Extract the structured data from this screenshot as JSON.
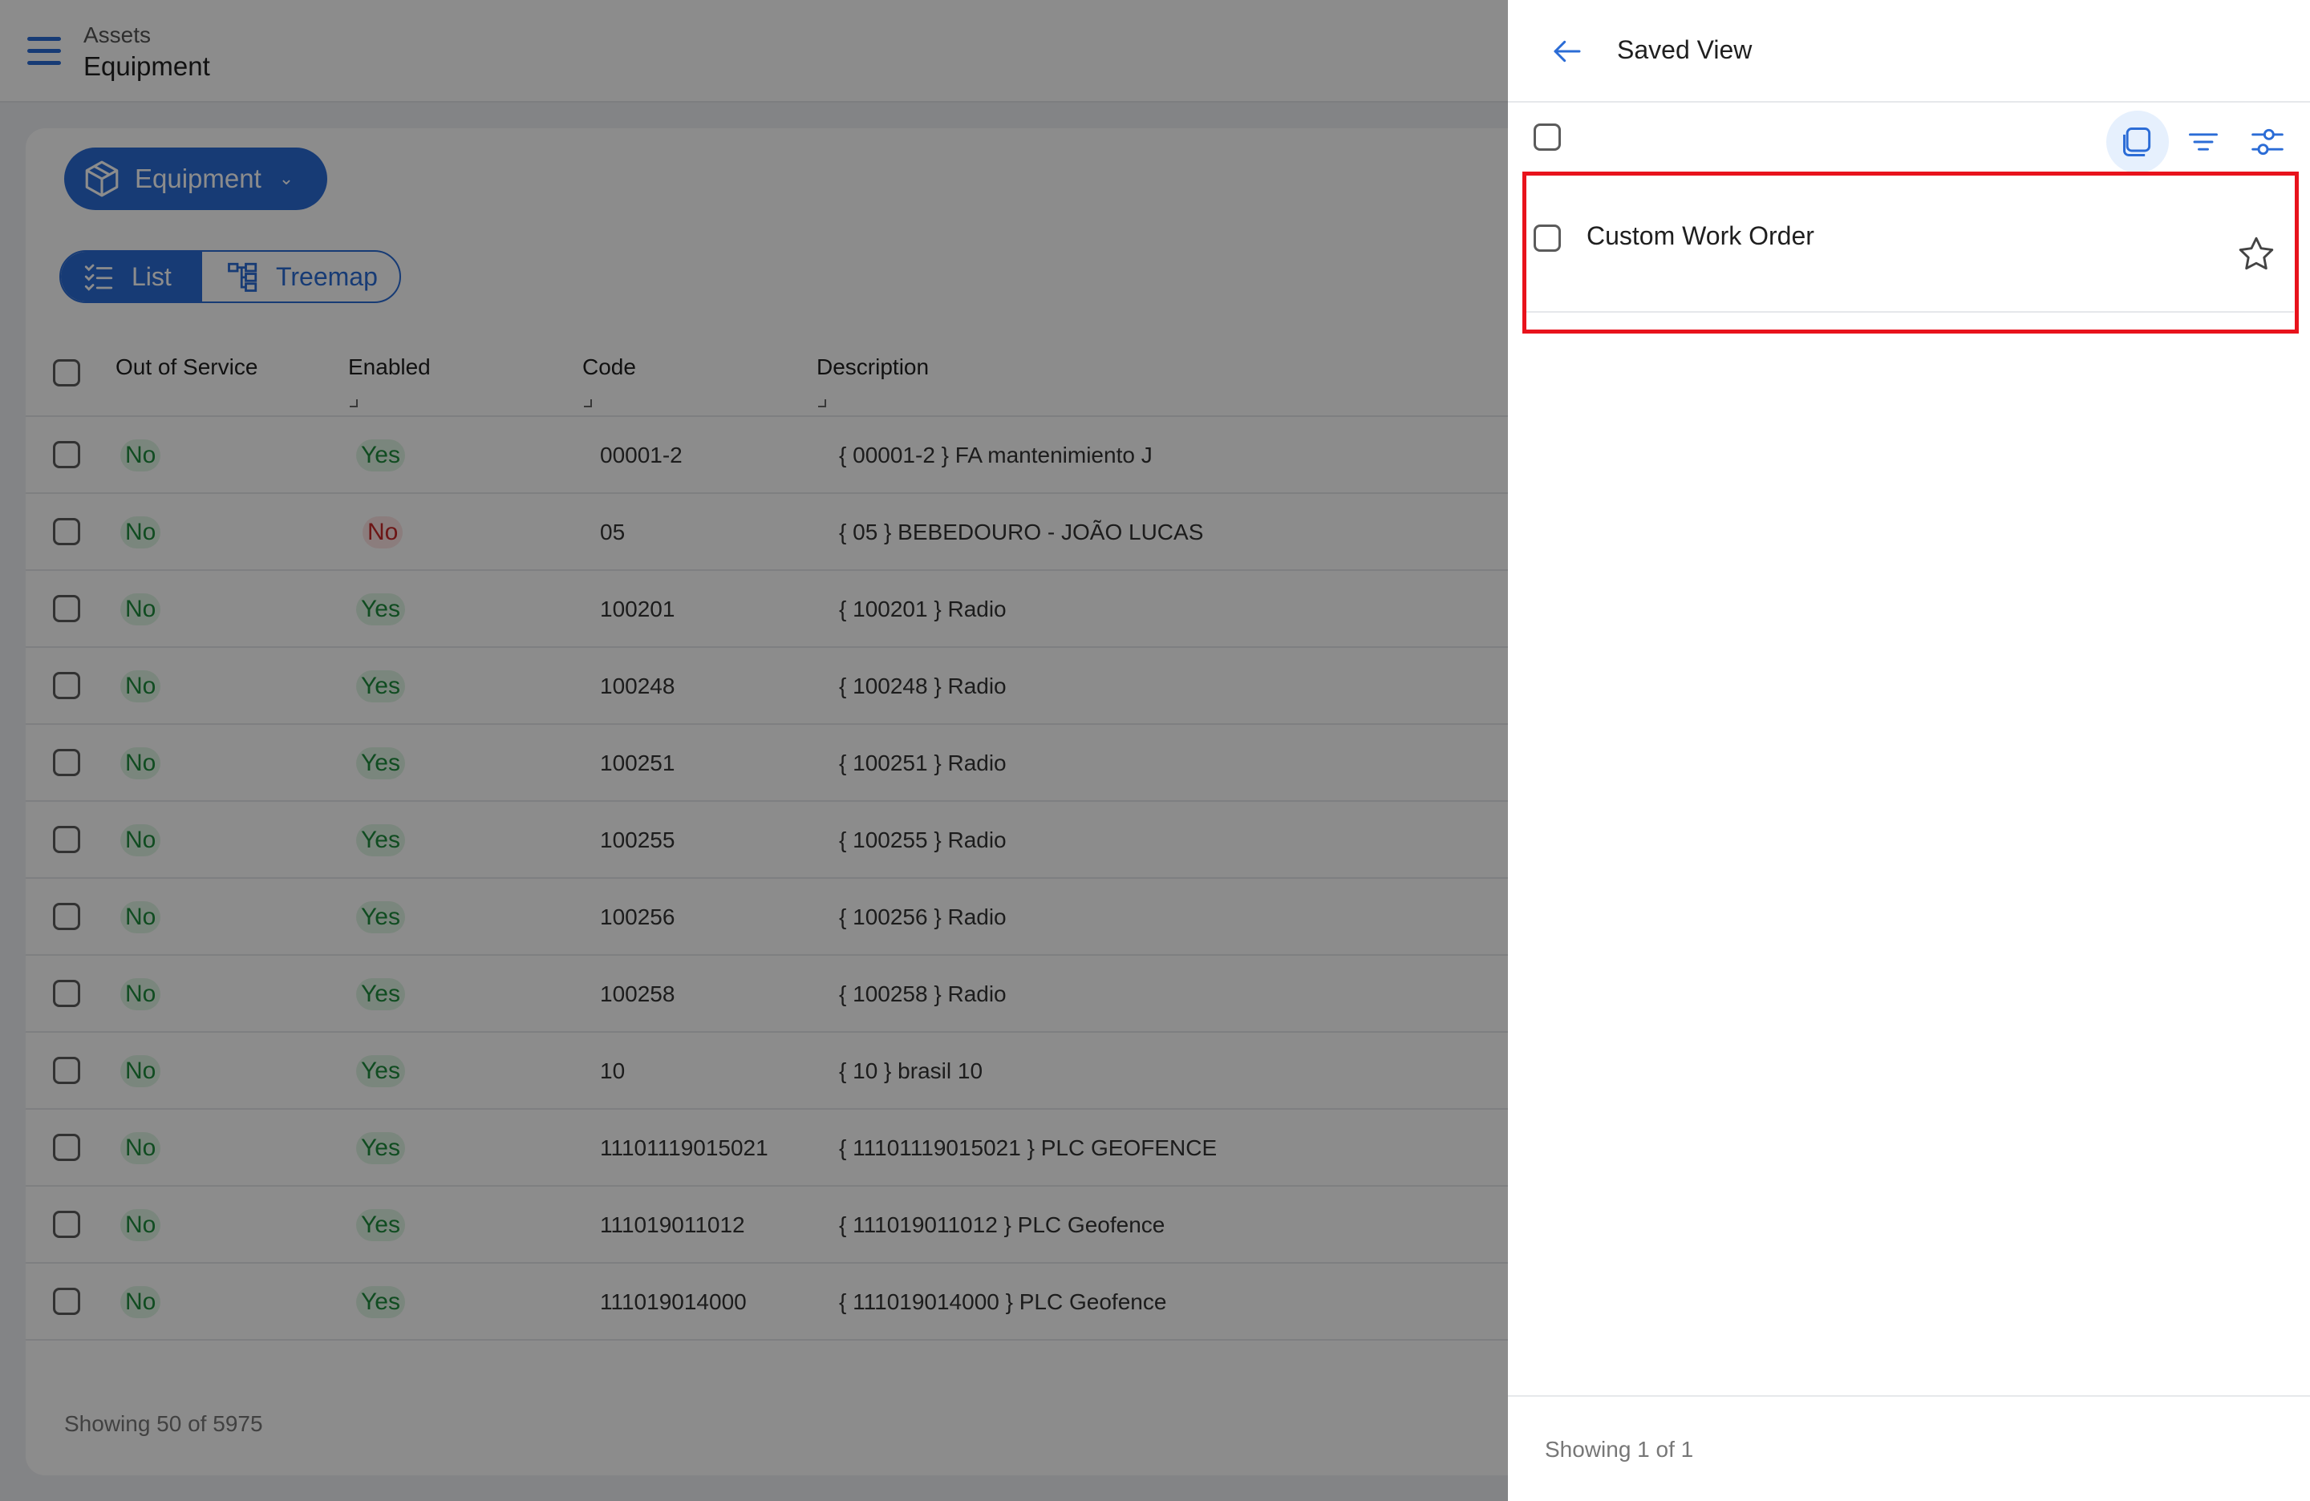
{
  "header": {
    "breadcrumb_parent": "Assets",
    "breadcrumb_current": "Equipment"
  },
  "toolbar": {
    "entity_label": "Equipment",
    "view_list_label": "List",
    "view_treemap_label": "Treemap"
  },
  "table": {
    "columns": [
      "Out of Service",
      "Enabled",
      "Code",
      "Description"
    ],
    "rows": [
      {
        "out_of_service": "No",
        "enabled": "Yes",
        "code": "00001-2",
        "description": "{ 00001-2 } FA mantenimiento J"
      },
      {
        "out_of_service": "No",
        "enabled": "No",
        "code": "05",
        "description": "{ 05 } BEBEDOURO - JOÃO LUCAS"
      },
      {
        "out_of_service": "No",
        "enabled": "Yes",
        "code": "100201",
        "description": "{ 100201 } Radio"
      },
      {
        "out_of_service": "No",
        "enabled": "Yes",
        "code": "100248",
        "description": "{ 100248 } Radio"
      },
      {
        "out_of_service": "No",
        "enabled": "Yes",
        "code": "100251",
        "description": "{ 100251 } Radio"
      },
      {
        "out_of_service": "No",
        "enabled": "Yes",
        "code": "100255",
        "description": "{ 100255 } Radio"
      },
      {
        "out_of_service": "No",
        "enabled": "Yes",
        "code": "100256",
        "description": "{ 100256 } Radio"
      },
      {
        "out_of_service": "No",
        "enabled": "Yes",
        "code": "100258",
        "description": "{ 100258 } Radio"
      },
      {
        "out_of_service": "No",
        "enabled": "Yes",
        "code": "10",
        "description": "{ 10 } brasil 10"
      },
      {
        "out_of_service": "No",
        "enabled": "Yes",
        "code": "11101119015021",
        "description": "{ 11101119015021 } PLC GEOFENCE"
      },
      {
        "out_of_service": "No",
        "enabled": "Yes",
        "code": "111019011012",
        "description": "{ 111019011012 } PLC Geofence"
      },
      {
        "out_of_service": "No",
        "enabled": "Yes",
        "code": "111019014000",
        "description": "{ 111019014000 } PLC Geofence"
      }
    ],
    "footer": "Showing 50 of 5975"
  },
  "drawer": {
    "title": "Saved View",
    "items": [
      {
        "name": "Custom Work Order"
      }
    ],
    "footer": "Showing 1 of 1"
  },
  "colors": {
    "primary": "#2b6cd6",
    "yes_text": "#1e8a3c",
    "no_enabled_text": "#c62828",
    "highlight": "#e8131c"
  },
  "icons": {
    "menu": "menu-icon",
    "entity": "box-icon",
    "list": "list-checks-icon",
    "treemap": "treemap-icon",
    "back": "arrow-left-icon",
    "copy": "copy-icon",
    "filter": "filter-icon",
    "adjust": "sliders-icon",
    "favorite": "star-icon"
  }
}
